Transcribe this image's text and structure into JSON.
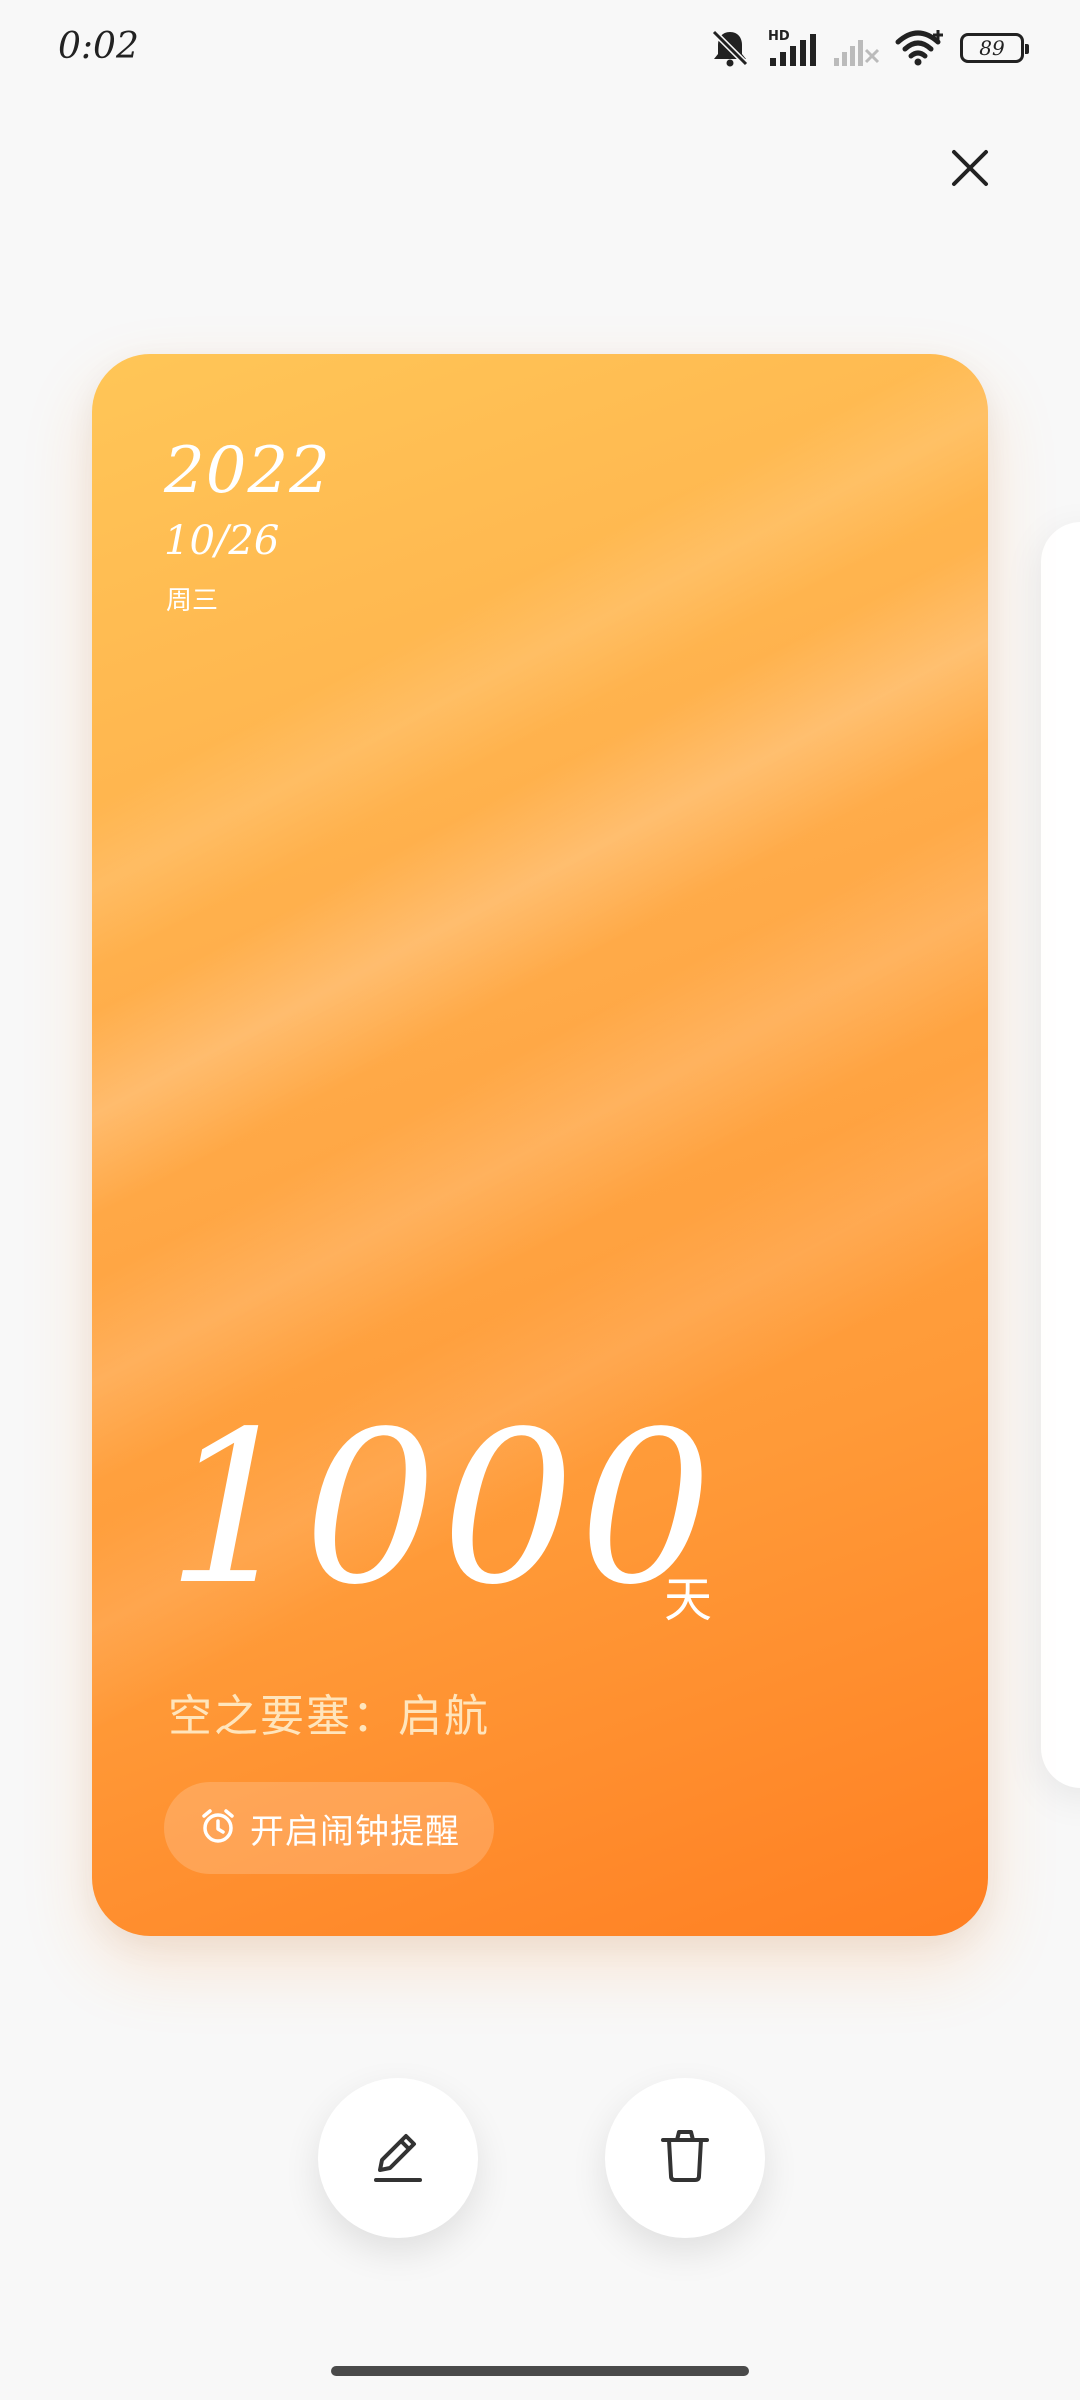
{
  "status_bar": {
    "time": "0:02",
    "network_label": "HD",
    "battery_level": "89"
  },
  "card": {
    "year": "2022",
    "month_day": "10/26",
    "weekday": "周三",
    "count": "1000",
    "count_unit": "天",
    "event_title": "空之要塞：启航",
    "alarm_label": "开启闹钟提醒",
    "gradient_colors": [
      "#ffc657",
      "#ff7f22"
    ]
  },
  "icons": {
    "close": "close-icon",
    "alarm": "alarm-clock-icon",
    "edit": "pencil-icon",
    "delete": "trash-icon"
  }
}
